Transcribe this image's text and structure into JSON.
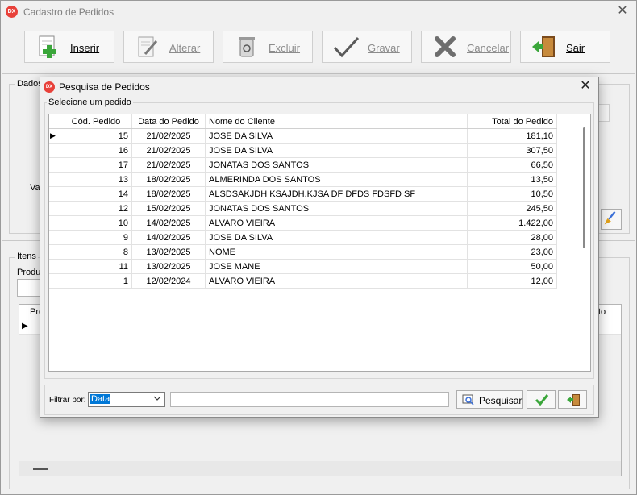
{
  "main": {
    "title": "Cadastro de Pedidos",
    "logo_text": "DX",
    "close_symbol": "✕"
  },
  "toolbar": {
    "buttons": [
      {
        "label": "Inserir",
        "icon": "document-add-icon",
        "enabled": true
      },
      {
        "label": "Alterar",
        "icon": "edit-icon",
        "enabled": false
      },
      {
        "label": "Excluir",
        "icon": "recycle-bin-icon",
        "enabled": false
      },
      {
        "label": "Gravar",
        "icon": "checkmark-icon",
        "enabled": false
      },
      {
        "label": "Cancelar",
        "icon": "x-icon",
        "enabled": false
      },
      {
        "label": "Sair",
        "icon": "door-exit-icon",
        "enabled": true
      }
    ]
  },
  "background": {
    "dados_label": "Dados",
    "valor_label": "Val",
    "itens_label": "Itens",
    "produto_label": "Produ",
    "grid_col_left": "Pro",
    "grid_col_right": "to"
  },
  "dialog": {
    "title": "Pesquisa de Pedidos",
    "logo_text": "DX",
    "close_symbol": "✕",
    "group_label": "Selecione um pedido",
    "columns": [
      "Cód. Pedido",
      "Data do Pedido",
      "Nome do Cliente",
      "Total do Pedido"
    ],
    "rows": [
      {
        "codigo": "15",
        "data": "21/02/2025",
        "cliente": "JOSE DA SILVA",
        "total": "181,10"
      },
      {
        "codigo": "16",
        "data": "21/02/2025",
        "cliente": "JOSE DA SILVA",
        "total": "307,50"
      },
      {
        "codigo": "17",
        "data": "21/02/2025",
        "cliente": "JONATAS DOS SANTOS",
        "total": "66,50"
      },
      {
        "codigo": "13",
        "data": "18/02/2025",
        "cliente": "ALMERINDA DOS SANTOS",
        "total": "13,50"
      },
      {
        "codigo": "14",
        "data": "18/02/2025",
        "cliente": "ALSDSAKJDH KSAJDH.KJSA DF DFDS FDSFD SF",
        "total": "10,50"
      },
      {
        "codigo": "12",
        "data": "15/02/2025",
        "cliente": "JONATAS DOS SANTOS",
        "total": "245,50"
      },
      {
        "codigo": "10",
        "data": "14/02/2025",
        "cliente": "ALVARO VIEIRA",
        "total": "1.422,00"
      },
      {
        "codigo": "9",
        "data": "14/02/2025",
        "cliente": "JOSE DA SILVA",
        "total": "28,00"
      },
      {
        "codigo": "8",
        "data": "13/02/2025",
        "cliente": "NOME",
        "total": "23,00"
      },
      {
        "codigo": "11",
        "data": "13/02/2025",
        "cliente": "JOSE MANE",
        "total": "50,00"
      },
      {
        "codigo": "1",
        "data": "12/02/2024",
        "cliente": "ALVARO VIEIRA",
        "total": "12,00"
      }
    ],
    "filter_label": "Filtrar por:",
    "filter_value": "Data",
    "search_value": "",
    "search_button_label": "Pesquisar"
  },
  "colors": {
    "selection": "#0078d7",
    "logo_red": "#e8413a",
    "ok_green": "#3aa63a"
  }
}
